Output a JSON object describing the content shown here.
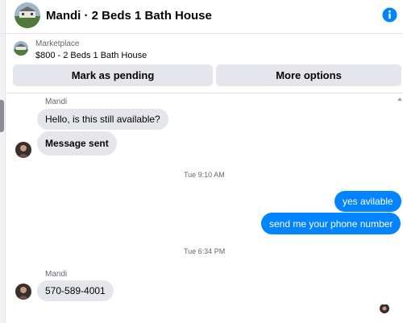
{
  "header": {
    "title": "Mandi · 2 Beds 1 Bath House",
    "info_icon": "info-icon",
    "accent": "#0084ff"
  },
  "marketplace": {
    "label": "Marketplace",
    "listing": "$800 - 2 Beds 1 Bath House",
    "buttons": {
      "pending": "Mark as pending",
      "more": "More options"
    }
  },
  "conversation": {
    "first_sender": "Mandi",
    "msg1": "Hello, is this still available?",
    "msg2": "Message sent",
    "timestamp1": "Tue 9:10 AM",
    "out1": "yes avilable",
    "out2": "send me your phone number",
    "timestamp2": "Tue 6:34 PM",
    "second_sender": "Mandi",
    "msg3": "570-589-4001"
  },
  "colors": {
    "incoming_bubble": "#e4e6eb",
    "outgoing_bubble": "#0084ff"
  }
}
